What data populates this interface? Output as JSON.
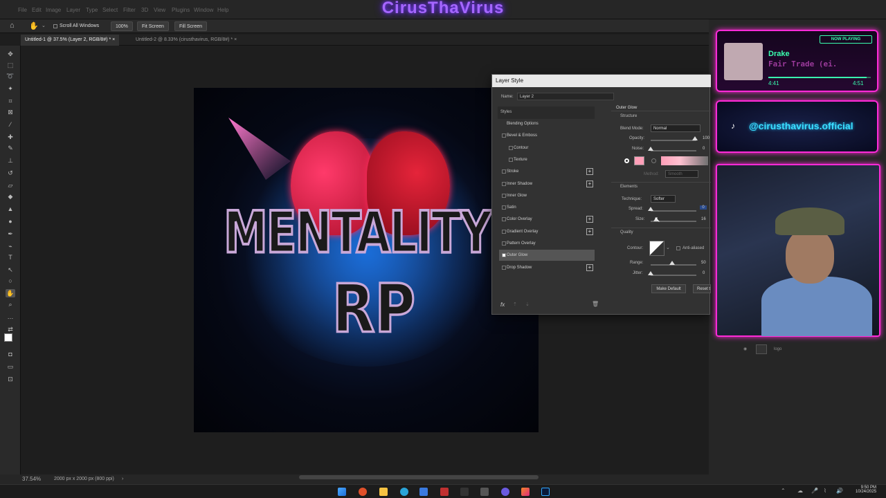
{
  "stream": {
    "title": "CirusThaVirus"
  },
  "menu": [
    "File",
    "Edit",
    "Image",
    "Layer",
    "Type",
    "Select",
    "Filter",
    "3D",
    "View",
    "Plugins",
    "Window",
    "Help"
  ],
  "options_bar": {
    "scroll_all": "Scroll All Windows",
    "zoom": "100%",
    "fit_screen": "Fit Screen",
    "fill_screen": "Fill Screen"
  },
  "doc_tabs": [
    {
      "label": "Untitled-1 @ 37.5% (Layer 2, RGB/8#) *"
    },
    {
      "label": "Untitled-2 @ 8.33% (cirusthavirus, RGB/8#) *"
    }
  ],
  "artwork": {
    "line1": "MENTALITY",
    "line2": "RP"
  },
  "status": {
    "zoom": "37.54%",
    "dims": "2000 px x 2000 px (800 ppi)"
  },
  "dialog": {
    "title": "Layer Style",
    "name_label": "Name:",
    "name_value": "Layer 2",
    "styles_header": "Styles",
    "styles": [
      {
        "label": "Blending Options",
        "checkbox": false,
        "plus": false,
        "indent": false
      },
      {
        "label": "Bevel & Emboss",
        "checkbox": true,
        "plus": false,
        "indent": false
      },
      {
        "label": "Contour",
        "checkbox": true,
        "plus": false,
        "indent": true
      },
      {
        "label": "Texture",
        "checkbox": true,
        "plus": false,
        "indent": true
      },
      {
        "label": "Stroke",
        "checkbox": true,
        "plus": true,
        "indent": false
      },
      {
        "label": "Inner Shadow",
        "checkbox": true,
        "plus": true,
        "indent": false
      },
      {
        "label": "Inner Glow",
        "checkbox": true,
        "plus": false,
        "indent": false
      },
      {
        "label": "Satin",
        "checkbox": true,
        "plus": false,
        "indent": false
      },
      {
        "label": "Color Overlay",
        "checkbox": true,
        "plus": true,
        "indent": false
      },
      {
        "label": "Gradient Overlay",
        "checkbox": true,
        "plus": true,
        "indent": false
      },
      {
        "label": "Pattern Overlay",
        "checkbox": true,
        "plus": false,
        "indent": false
      },
      {
        "label": "Outer Glow",
        "checkbox": true,
        "plus": false,
        "indent": false,
        "checked": true,
        "selected": true
      },
      {
        "label": "Drop Shadow",
        "checkbox": true,
        "plus": true,
        "indent": false
      }
    ],
    "section_title": "Outer Glow",
    "structure_title": "Structure",
    "blend_mode_label": "Blend Mode:",
    "blend_mode_value": "Normal",
    "opacity_label": "Opacity:",
    "opacity_value": "100",
    "noise_label": "Noise:",
    "noise_value": "0",
    "glow_color": "#ff9fb8",
    "method_label": "Method:",
    "method_value": "Smooth",
    "elements_title": "Elements",
    "technique_label": "Technique:",
    "technique_value": "Softer",
    "spread_label": "Spread:",
    "spread_value": "0",
    "size_label": "Size:",
    "size_value": "16",
    "quality_title": "Quality",
    "contour_label": "Contour:",
    "anti_aliased_label": "Anti-aliased",
    "range_label": "Range:",
    "range_value": "50",
    "jitter_label": "Jitter:",
    "jitter_value": "0",
    "make_default": "Make Default",
    "reset_default": "Reset t",
    "fx_label": "fx"
  },
  "now_playing": {
    "badge": "NOW PLAYING",
    "artist": "Drake",
    "track": "Fair Trade (ei.",
    "elapsed": "4:41",
    "total": "4:51",
    "progress": 0.96
  },
  "tiktok": {
    "handle": "@cirusthavirus.official"
  },
  "layers": {
    "row_label": "logo"
  },
  "taskbar": {
    "time": "9:50 PM",
    "date": "10/24/2025"
  },
  "colors": {
    "accent_neon_pink": "#ff2ad8",
    "neon_green": "#3affb0",
    "neon_cyan": "#3adfff"
  }
}
